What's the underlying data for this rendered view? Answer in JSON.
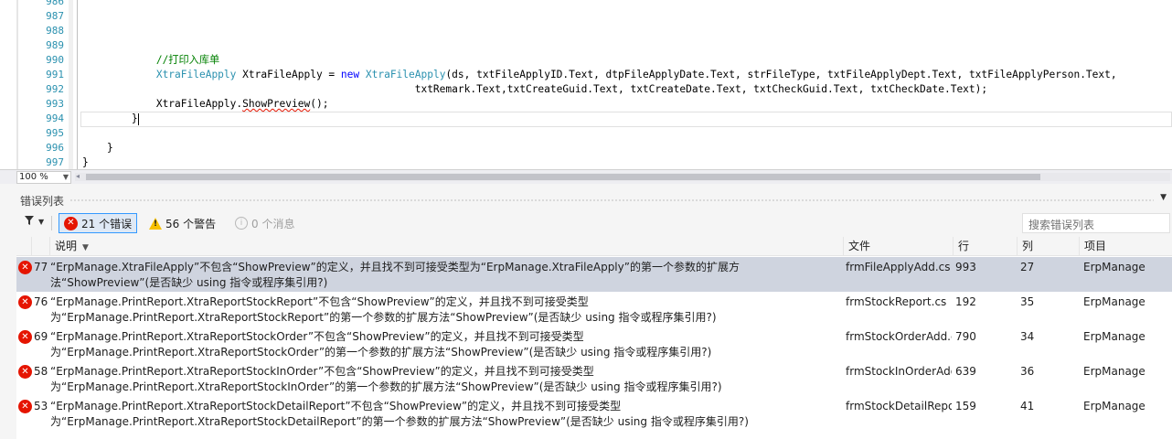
{
  "editor": {
    "line_numbers": [
      "986",
      "987",
      "988",
      "989",
      "990",
      "991",
      "992",
      "993",
      "994",
      "995",
      "996",
      "997"
    ],
    "lines": {
      "l990_comment": "//打印入库单",
      "l991_type": "XtraFileApply",
      "l991_var": " XtraFileApply = ",
      "l991_new": "new",
      "l991_sp": " ",
      "l991_ctor": "XtraFileApply",
      "l991_args": "(ds, txtFileApplyID.Text, dtpFileApplyDate.Text, strFileType, txtFileApplyDept.Text, txtFileApplyPerson.Text,",
      "l992": "txtRemark.Text,txtCreateGuid.Text, txtCreateDate.Text, txtCheckGuid.Text, txtCheckDate.Text);",
      "l993_obj": "XtraFileApply.",
      "l993_method": "ShowPreview",
      "l993_tail": "();",
      "l994": "}",
      "l996": "}",
      "l997": "}"
    },
    "zoom": "100 %"
  },
  "error_list": {
    "title": "错误列表",
    "errors_label": "21 个错误",
    "warnings_label": "56 个警告",
    "messages_label": "0 个消息",
    "search_placeholder": "搜索错误列表",
    "columns": {
      "description": "说明",
      "file": "文件",
      "line": "行",
      "column": "列",
      "project": "项目"
    },
    "rows": [
      {
        "code": "77",
        "desc": "“ErpManage.XtraFileApply”不包含“ShowPreview”的定义，并且找不到可接受类型为“ErpManage.XtraFileApply”的第一个参数的扩展方\n法“ShowPreview”(是否缺少 using 指令或程序集引用?)",
        "file": "frmFileApplyAdd.cs",
        "line": "993",
        "col": "27",
        "project": "ErpManage"
      },
      {
        "code": "76",
        "desc": "“ErpManage.PrintReport.XtraReportStockReport”不包含“ShowPreview”的定义，并且找不到可接受类型\n为“ErpManage.PrintReport.XtraReportStockReport”的第一个参数的扩展方法“ShowPreview”(是否缺少 using 指令或程序集引用?)",
        "file": "frmStockReport.cs",
        "line": "192",
        "col": "35",
        "project": "ErpManage"
      },
      {
        "code": "69",
        "desc": "“ErpManage.PrintReport.XtraReportStockOrder”不包含“ShowPreview”的定义，并且找不到可接受类型\n为“ErpManage.PrintReport.XtraReportStockOrder”的第一个参数的扩展方法“ShowPreview”(是否缺少 using 指令或程序集引用?)",
        "file": "frmStockOrderAdd.cs",
        "line": "790",
        "col": "34",
        "project": "ErpManage"
      },
      {
        "code": "58",
        "desc": "“ErpManage.PrintReport.XtraReportStockInOrder”不包含“ShowPreview”的定义，并且找不到可接受类型\n为“ErpManage.PrintReport.XtraReportStockInOrder”的第一个参数的扩展方法“ShowPreview”(是否缺少 using 指令或程序集引用?)",
        "file": "frmStockInOrderAdd.cs",
        "line": "639",
        "col": "36",
        "project": "ErpManage"
      },
      {
        "code": "53",
        "desc": "“ErpManage.PrintReport.XtraReportStockDetailReport”不包含“ShowPreview”的定义，并且找不到可接受类型\n为“ErpManage.PrintReport.XtraReportStockDetailReport”的第一个参数的扩展方法“ShowPreview”(是否缺少 using 指令或程序集引用?)",
        "file": "frmStockDetailReport.cs",
        "line": "159",
        "col": "41",
        "project": "ErpManage"
      }
    ]
  }
}
